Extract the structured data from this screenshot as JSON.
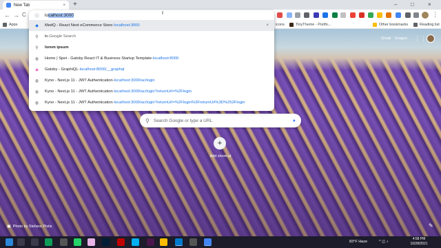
{
  "tab": {
    "title": "New Tab",
    "close": "×",
    "new": "+"
  },
  "window": {
    "minimize": "–",
    "maximize": "□",
    "close": "×"
  },
  "toolbar": {
    "back": "←",
    "forward": "→",
    "reload": "C"
  },
  "bookmarks": {
    "apps": "Apps",
    "icons": "icons",
    "tiny_theme": "TinyTheme - Portfo...",
    "other": "Other bookmarks",
    "reading": "Reading list",
    "more": "»"
  },
  "omnibox": {
    "typed": "lo",
    "autocomplete": "calhost:3000",
    "rows": [
      {
        "title": "MedQ - React Next eCommerce Store",
        "sep": " - ",
        "url": "localhost:3000",
        "icon": "medq-icon",
        "close": "×"
      },
      {
        "title": "lo",
        "sep": " - ",
        "suffix": "Google Search",
        "icon": "search-icon"
      },
      {
        "title": "lorem ipsum",
        "icon": "search-icon"
      },
      {
        "title": "Home | Spet - Gatsby React IT & Business Startup Template",
        "sep": " - ",
        "url": "localhost:8000",
        "icon": "globe-icon"
      },
      {
        "title": "Gatsby - GraphiQL",
        "sep": " - ",
        "url": "localhost:8000/__graphql",
        "icon": "graphql-icon"
      },
      {
        "title": "Kyno - Next.js 11 - JWT Authentication",
        "sep": " - ",
        "url": "localhost:3000/ac/login",
        "icon": "globe-icon"
      },
      {
        "title": "Kyno - Next.js 11 - JWT Authentication",
        "sep": " - ",
        "url": "localhost:3000/ac/login?returnUrl=%2Flogin",
        "icon": "globe-icon"
      },
      {
        "title": "Kyno - Next.js 11 - JWT Authentication",
        "sep": " - ",
        "url": "localhost:3000/ac/login?returnUrl=%2Flogin%3FreturnUrl%3D%252Flogin",
        "icon": "globe-icon"
      }
    ]
  },
  "ntp": {
    "gmail": "Gmail",
    "images": "Images",
    "search_placeholder": "Search Google or type a URL",
    "add_shortcut": "Add shortcut",
    "add_symbol": "+",
    "photo_credit": "Photo by Stefano Pistis"
  },
  "taskbar": {
    "weather": "83°F Haze",
    "time": "4:58 PM",
    "date": "10/28/2021"
  },
  "colors": {
    "accent": "#1a73e8",
    "lavender": "#6b45a6",
    "taskbar": "#1c1c2a"
  }
}
